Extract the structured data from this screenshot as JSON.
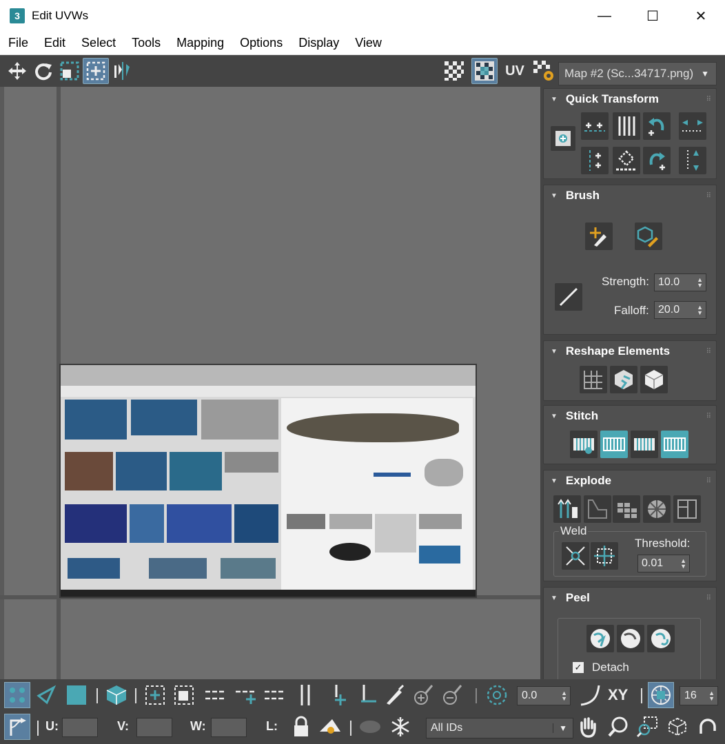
{
  "window": {
    "app_logo": "3",
    "title": "Edit UVWs",
    "minimize": "—",
    "maximize": "☐",
    "close": "✕"
  },
  "menu": [
    "File",
    "Edit",
    "Select",
    "Tools",
    "Mapping",
    "Options",
    "Display",
    "View"
  ],
  "toolbar": {
    "uv_label": "UV",
    "map_select": "Map #2 (Sc...34717.png)",
    "map_arrow": "▼"
  },
  "panels": {
    "quick_transform": {
      "title": "Quick Transform"
    },
    "brush": {
      "title": "Brush",
      "strength_label": "Strength:",
      "strength_value": "10.0",
      "falloff_label": "Falloff:",
      "falloff_value": "20.0"
    },
    "reshape": {
      "title": "Reshape Elements"
    },
    "stitch": {
      "title": "Stitch"
    },
    "explode": {
      "title": "Explode",
      "weld_label": "Weld",
      "threshold_label": "Threshold:",
      "threshold_value": "0.01"
    },
    "peel": {
      "title": "Peel",
      "detach_label": "Detach",
      "detach_checked": true
    }
  },
  "bottom_bar1": {
    "angle_value": "0.0",
    "xy_label": "XY",
    "grid_value": "16"
  },
  "bottom_bar2": {
    "u_label": "U:",
    "v_label": "V:",
    "w_label": "W:",
    "l_label": "L:",
    "ids_select": "All IDs"
  },
  "colors": {
    "accent": "#4aa8b4",
    "panel_bg": "#505050",
    "viewport_bg": "#6f6f6f",
    "active_blue": "#5a7fa0"
  }
}
